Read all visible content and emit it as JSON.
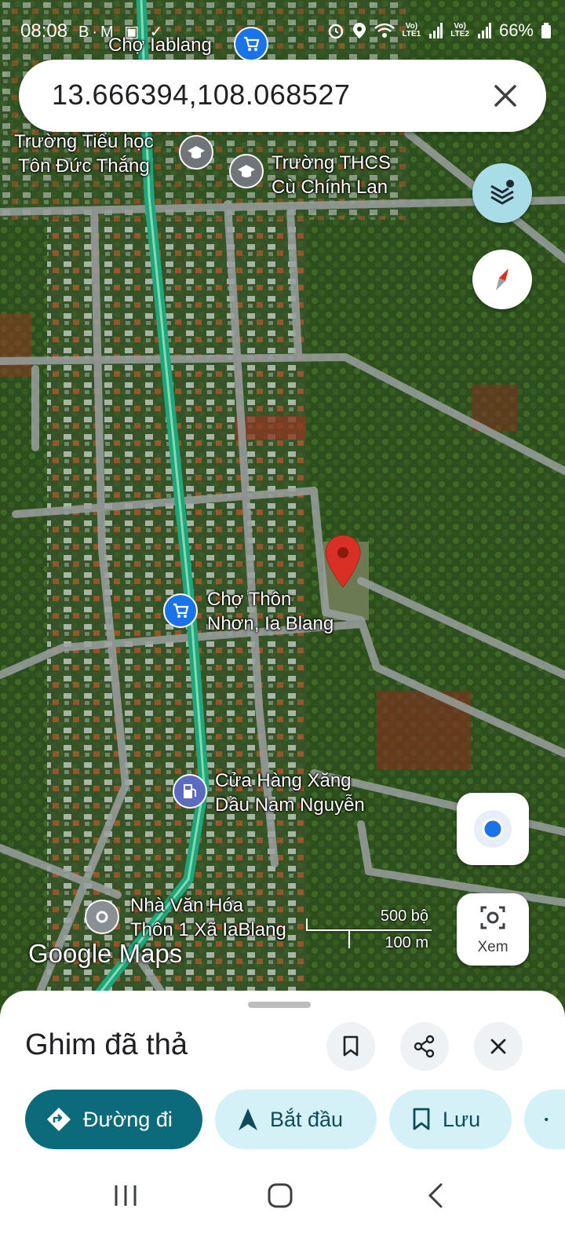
{
  "status_bar": {
    "time": "08:08",
    "icons": "B·M ▣ ✓",
    "battery": "66%",
    "sim1": "LTE1",
    "sim2": "LTE2"
  },
  "search": {
    "value": "13.666394,108.068527",
    "close_icon": "close-icon"
  },
  "map": {
    "places": [
      {
        "id": "cho-iablang",
        "text": "Chợ Iablang",
        "kind": "shop"
      },
      {
        "id": "truong-ton-duc-thang",
        "text": "Trường Tiểu học\nTôn Đức Thắng",
        "kind": "school"
      },
      {
        "id": "truong-cu-chinh-lan",
        "text": "Trường THCS\nCù Chính Lan",
        "kind": "school"
      },
      {
        "id": "cho-thon-nhon",
        "text": "Chợ Thôn\nNhơn, Ia Blang",
        "kind": "shop"
      },
      {
        "id": "cua-hang-xang-dau",
        "text": "Cửa Hàng Xăng\nDầu Nam Nguyễn",
        "kind": "fuel"
      },
      {
        "id": "nha-van-hoa",
        "text": "Nhà Văn Hóa\nThôn 1 Xã IaBlang",
        "kind": "place"
      }
    ],
    "scale": {
      "top": "500 bộ",
      "bottom": "100 m"
    },
    "logo": "Google Maps",
    "view_button_label": "Xem",
    "colors": {
      "pin": "#d93025",
      "road_highlight": "#1fa67a",
      "shop_poi": "#1a73e8",
      "school_poi": "#70757a"
    }
  },
  "sheet": {
    "title": "Ghim đã thả",
    "actions": [
      {
        "label": "Đường đi",
        "icon": "directions-icon"
      },
      {
        "label": "Bắt đầu",
        "icon": "navigation-arrow-icon"
      },
      {
        "label": "Lưu",
        "icon": "bookmark-icon"
      }
    ]
  },
  "accent": "#0b6b7a"
}
